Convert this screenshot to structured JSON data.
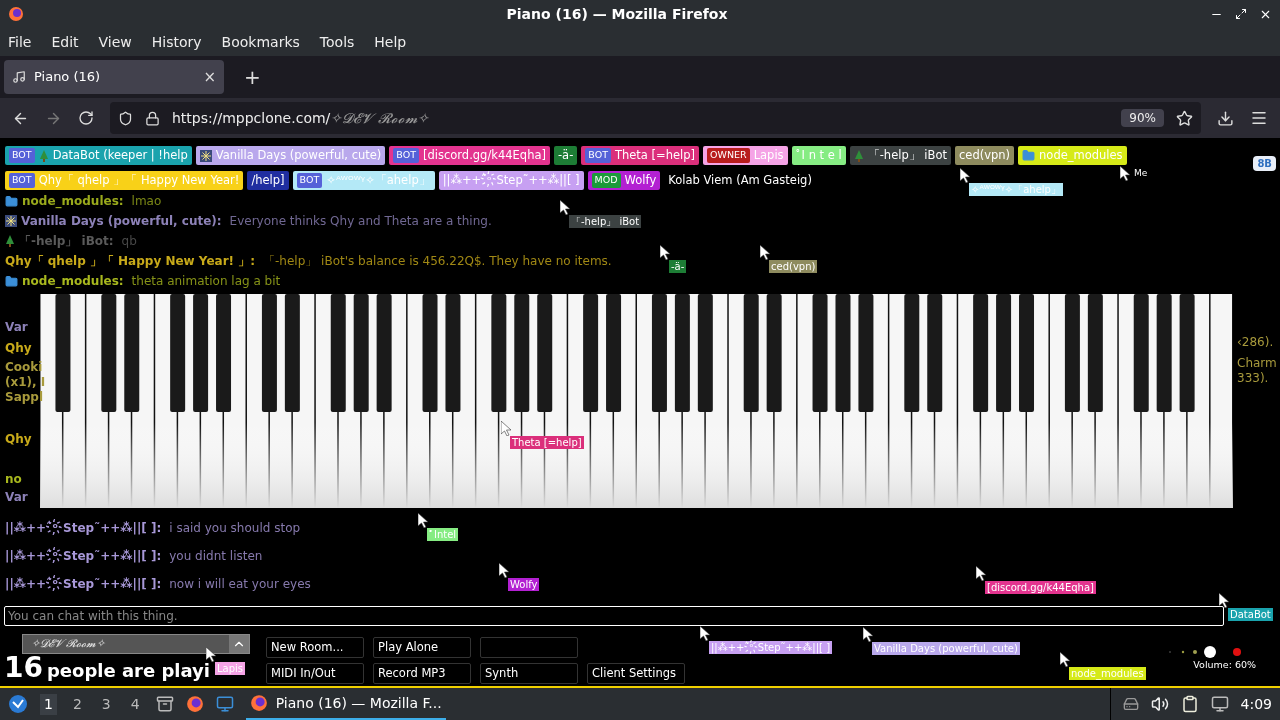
{
  "window": {
    "title": "Piano (16) — Mozilla Firefox"
  },
  "menu": [
    "File",
    "Edit",
    "View",
    "History",
    "Bookmarks",
    "Tools",
    "Help"
  ],
  "tabs": [
    {
      "label": "Piano (16)",
      "selected": true,
      "close": "×"
    }
  ],
  "new_tab": "+",
  "url": {
    "prefix": "https://mppclone.com/",
    "path": "✧𝓓𝓔𝓥 𝓡𝓸𝓸𝓶✧"
  },
  "zoom": "90%",
  "users": [
    {
      "kind": "tree",
      "badge": "BOT",
      "name": "DataBot (keeper | !help",
      "color": "#1aa3ad"
    },
    {
      "kind": "firework",
      "name": "Vanilla Days (powerful, cute)",
      "color": "#b9a8ec"
    },
    {
      "kind": "plain",
      "badge": "BOT",
      "name": "[discord.gg/k44Eqha]",
      "color": "#e3348f"
    },
    {
      "kind": "plain",
      "name": "-ä-",
      "color": "#1d7d35"
    },
    {
      "kind": "plain",
      "badge": "BOT",
      "name": "Theta [=help]",
      "color": "#db2f7b"
    },
    {
      "kind": "plain",
      "badge": "OWNER",
      "name": "Lapis",
      "color": "#f5a3e6"
    },
    {
      "kind": "plain",
      "name": "ﾟI n t e l",
      "color": "#86ec83"
    },
    {
      "kind": "tree",
      "name": "「-help」 iBot",
      "color": "#3c4242"
    },
    {
      "kind": "plain",
      "name": "ced(vpn)",
      "color": "#8e8b5e"
    },
    {
      "kind": "folder",
      "name": "node_modules",
      "color": "#d6ea18"
    },
    {
      "kind": "plain",
      "badge": "BOT",
      "name": "Qhy「 qhelp 」「 Happy New Year!",
      "color": "#f8d118"
    },
    {
      "kind": "plain",
      "name": "/help]",
      "color": "#202ea0"
    },
    {
      "kind": "plain",
      "badge": "BOT",
      "name": "✧ᴬᵂᴼᵂᵞ✧「ahelp」",
      "color": "#b4e9f7"
    },
    {
      "kind": "plain",
      "name": "||⁂++˜ᵒ҉Step˜++⁂||[ ]",
      "color": "#c7a0f2"
    },
    {
      "kind": "plain",
      "badge": "MOD",
      "name": "Wolfy",
      "color": "#b320d2"
    },
    {
      "kind": "plain",
      "name": "Kolab Viem (Am Gasteig)",
      "color": "#000000"
    }
  ],
  "top_button": "8B",
  "chat_top": [
    {
      "kind": "folder",
      "name": "node_modules:",
      "message": "lmao",
      "color": "#9aaa1c"
    },
    {
      "kind": "firework",
      "name": "Vanilla Days (powerful, cute):",
      "message": "Everyone thinks Qhy and Theta are a thing.",
      "color": "#8d82b8"
    },
    {
      "kind": "tree",
      "name": "「-help」 iBot:",
      "message": "qb",
      "color": "#5a5a5a"
    },
    {
      "kind": "plain",
      "name": "Qhy「 qhelp 」「 Happy New Year! 」:",
      "message": "「-help」 iBot's balance is 456.22Q$. They have no items.",
      "color": "#c8aa1a"
    },
    {
      "kind": "folder",
      "name": "node_modules:",
      "message": "theta animation lag a bit",
      "color": "#a8b81e"
    }
  ],
  "fragments_left": [
    {
      "text": "Var",
      "color": "#8d82b8"
    },
    {
      "text": "Qhy",
      "color": "#c8aa1a"
    },
    {
      "text": "Cooki",
      "color": "#a89a3c"
    },
    {
      "text": "(x1), I",
      "color": "#a89a3c"
    },
    {
      "text": "Sappl",
      "color": "#a89a3c"
    },
    {
      "text": "Qhy",
      "color": "#c8aa1a"
    },
    {
      "text": "no",
      "color": "#a8b81e"
    },
    {
      "text": "Var",
      "color": "#8d82b8"
    }
  ],
  "fragments_right": [
    {
      "text": "‹286).",
      "color": "#a89a3c"
    },
    {
      "text": "Charm",
      "color": "#a89a3c"
    },
    {
      "text": "333).",
      "color": "#a89a3c"
    }
  ],
  "chat_bottom": [
    {
      "name": "||⁂++˜ᵒ҉Step˜++⁂||[ ]:",
      "message": "i said you should stop",
      "color": "#a898d8"
    },
    {
      "name": "||⁂++˜ᵒ҉Step˜++⁂||[ ]:",
      "message": "you didnt listen",
      "color": "#a898d8"
    },
    {
      "name": "||⁂++˜ᵒ҉Step˜++⁂||[ ]:",
      "message": "now i will eat your eyes",
      "color": "#a898d8"
    }
  ],
  "chat_input": {
    "placeholder": "You can chat with this thing."
  },
  "room": {
    "value": "✧𝓓𝓔𝓥 𝓡𝓸𝓸𝓶✧",
    "count": "16",
    "count_label": "people are playi"
  },
  "buttons": [
    {
      "kind": "button",
      "label": "New Room..."
    },
    {
      "kind": "button",
      "label": "Play Alone"
    },
    {
      "kind": "blank"
    },
    {
      "kind": "spacer"
    },
    {
      "kind": "button",
      "label": "MIDI In/Out"
    },
    {
      "kind": "button",
      "label": "Record MP3"
    },
    {
      "kind": "button",
      "label": "Synth"
    },
    {
      "kind": "button",
      "label": "Client Settings"
    }
  ],
  "volume": "Volume: 60%",
  "cursors": [
    {
      "kind": "tag",
      "label": "-ä-",
      "color": "#1d7d35"
    },
    {
      "kind": "tag",
      "label": "ced(vpn)",
      "color": "#8e8b5e"
    },
    {
      "kind": "tag",
      "label": "✧ᴬᵂᴼᵂᵞ✧「ahelp」",
      "color": "#b4e9f7"
    },
    {
      "kind": "tag",
      "label": "「-help」 iBot",
      "color": "#3c4242"
    },
    {
      "kind": "tag",
      "label": "Theta [=help]",
      "color": "#db2f7b"
    },
    {
      "kind": "tag",
      "label": "ﾟIntel",
      "color": "#86ec83"
    },
    {
      "kind": "tag",
      "label": "Wolfy",
      "color": "#b320d2"
    },
    {
      "kind": "tag",
      "label": "[discord.gg/k44Eqha]",
      "color": "#e3348f"
    },
    {
      "kind": "tag",
      "label": "DataBot",
      "color": "#1aa3ad"
    },
    {
      "kind": "tag",
      "label": "node_modules",
      "color": "#d6ea18"
    },
    {
      "kind": "tag",
      "label": "||⁂++˜ᵒ҉Step˜++⁂||[ ]",
      "color": "#c7a0f2"
    },
    {
      "kind": "tag",
      "label": "Vanilla Days (powerful, cute)",
      "color": "#b9a8ec"
    },
    {
      "kind": "tag",
      "label": "Lapis",
      "color": "#f5a3e6"
    },
    {
      "kind": "self",
      "label": "Me"
    }
  ],
  "taskbar": {
    "workspaces": [
      {
        "label": "1",
        "selected": true
      },
      {
        "label": "2",
        "selected": false
      },
      {
        "label": "3",
        "selected": false
      },
      {
        "label": "4",
        "selected": false
      }
    ],
    "task": "Piano (16) — Mozilla F...",
    "clock": "4:09"
  }
}
